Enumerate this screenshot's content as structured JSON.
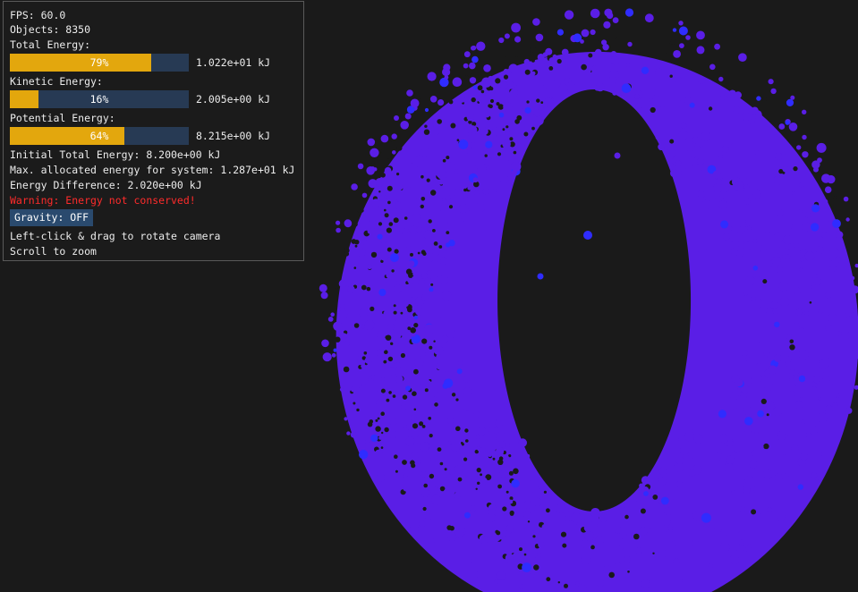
{
  "hud": {
    "fps": "FPS: 60.0",
    "objects": "Objects: 8350",
    "bars": [
      {
        "label": "Total Energy:",
        "fraction": 0.79,
        "pct": "79%",
        "value": "1.022e+01 kJ"
      },
      {
        "label": "Kinetic Energy:",
        "fraction": 0.16,
        "pct": "16%",
        "value": "2.005e+00 kJ"
      },
      {
        "label": "Potential Energy:",
        "fraction": 0.64,
        "pct": "64%",
        "value": "8.215e+00 kJ"
      }
    ],
    "initial_total": "Initial Total Energy: 8.200e+00 kJ",
    "max_allocated": "Max. allocated energy for system: 1.287e+01 kJ",
    "energy_diff": "Energy Difference: 2.020e+00 kJ",
    "warning": "Warning: Energy not conserved!",
    "gravity_button": "Gravity: OFF",
    "hint_rotate": "Left-click & drag to rotate camera",
    "hint_zoom": "Scroll to zoom"
  },
  "colors": {
    "background": "#1a1a1a",
    "bar_fill": "#e3a70d",
    "bar_track": "#273a54",
    "warning": "#ff2b2b",
    "particle": "#5a1ee6",
    "particle_highlight": "#2f2cff"
  }
}
